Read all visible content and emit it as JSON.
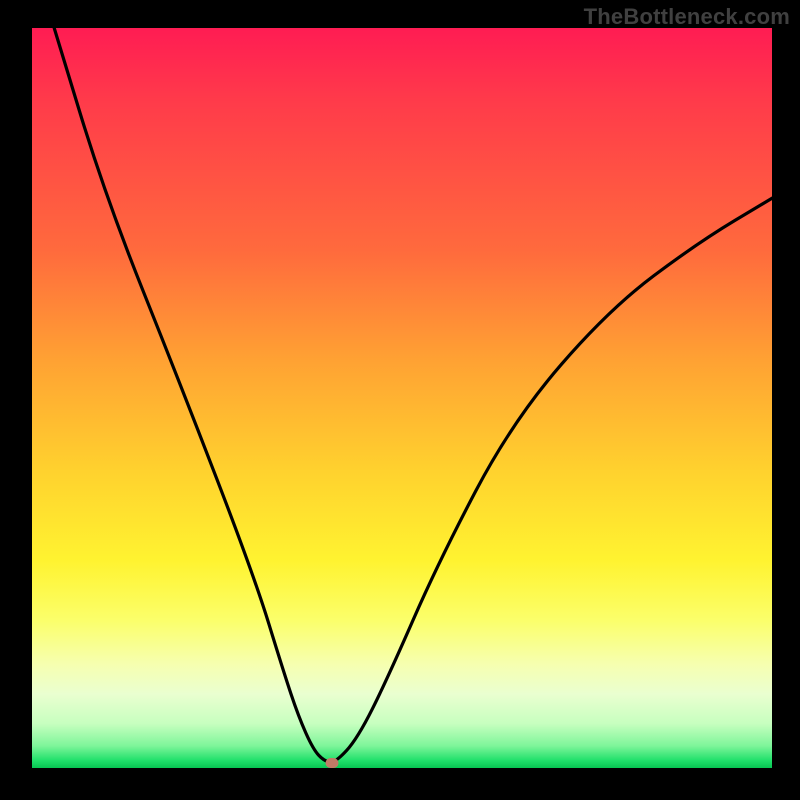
{
  "watermark": "TheBottleneck.com",
  "chart_data": {
    "type": "line",
    "title": "",
    "xlabel": "",
    "ylabel": "",
    "xlim": [
      0,
      100
    ],
    "ylim": [
      0,
      100
    ],
    "series": [
      {
        "name": "bottleneck-curve",
        "x": [
          3,
          10,
          20,
          30,
          34,
          36,
          38,
          39.5,
          41,
          44,
          48,
          55,
          65,
          78,
          90,
          100
        ],
        "y": [
          100,
          77,
          52,
          26,
          13,
          7,
          2.5,
          0.9,
          0.7,
          4,
          12,
          28,
          47,
          62,
          71,
          77
        ]
      }
    ],
    "marker": {
      "x": 40.5,
      "y": 0.7
    },
    "grid": false,
    "legend": false
  },
  "colors": {
    "curve": "#000000",
    "marker": "#c07a66",
    "gradient_top": "#ff1c53",
    "gradient_bottom": "#07c552",
    "frame": "#000000"
  }
}
